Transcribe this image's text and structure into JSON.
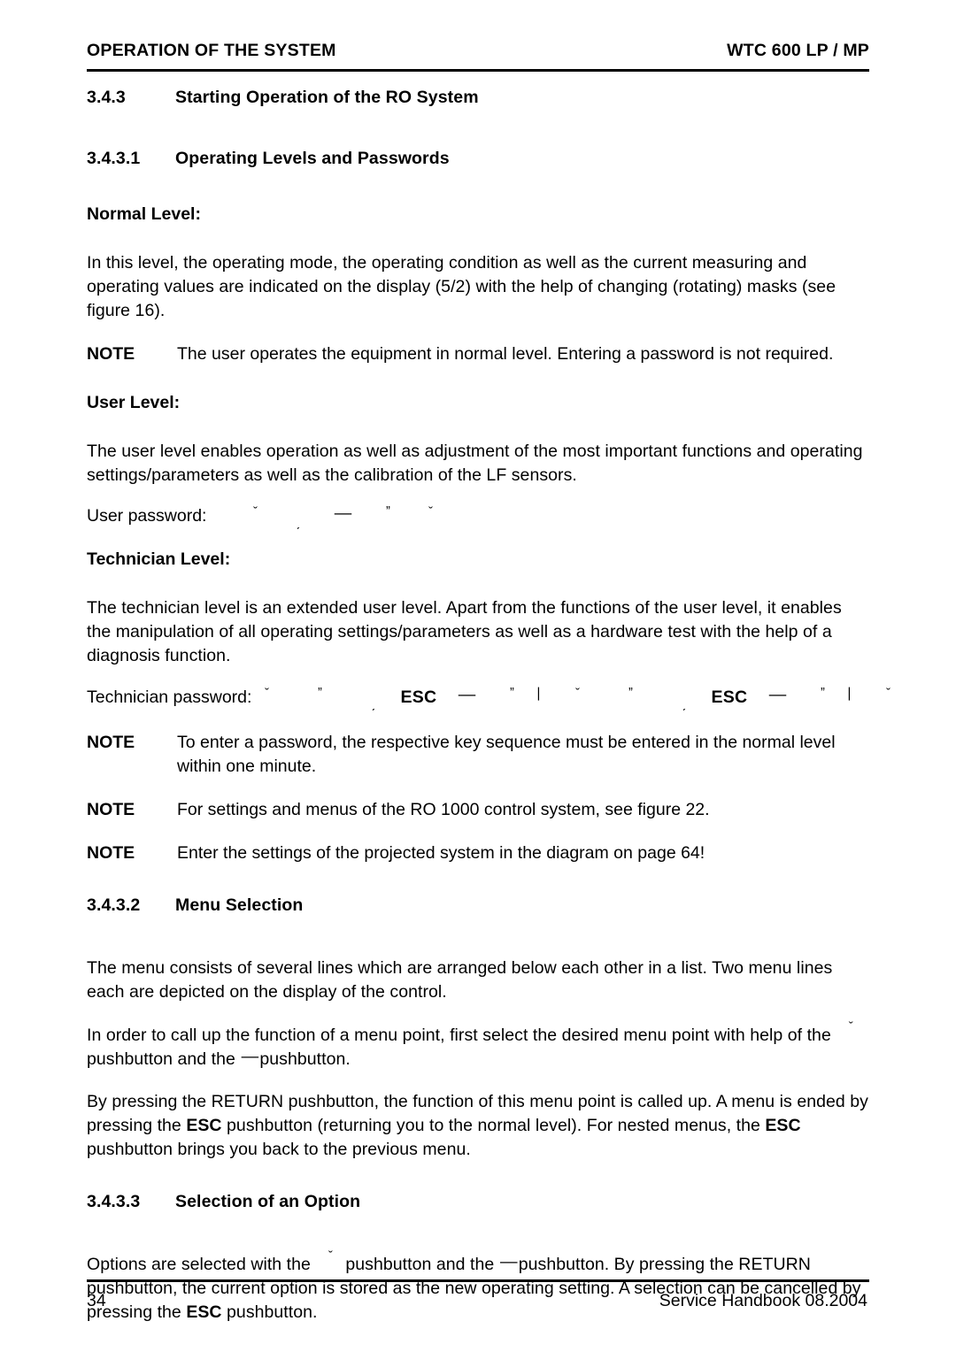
{
  "header": {
    "left": "OPERATION OF THE SYSTEM",
    "right": "WTC 600 LP / MP"
  },
  "sections": {
    "s343": {
      "num": "3.4.3",
      "title": "Starting Operation of the RO System"
    },
    "s3431": {
      "num": "3.4.3.1",
      "title": "Operating Levels and Passwords"
    },
    "s3432": {
      "num": "3.4.3.2",
      "title": "Menu Selection"
    },
    "s3433": {
      "num": "3.4.3.3",
      "title": "Selection of an Option"
    }
  },
  "normal_level": {
    "heading": "Normal Level:",
    "paragraph": "In this level, the operating mode, the operating condition as well as the current measuring and operating values are indicated on the display (5/2) with the help of changing (rotating) masks (see figure 16).",
    "note_label": "NOTE",
    "note_text": "The user operates the equipment in normal level. Entering a password is not required."
  },
  "user_level": {
    "heading": "User Level:",
    "paragraph": "The user level enables operation as well as adjustment of the most important functions and operating settings/parameters as well as the calibration of the LF sensors.",
    "password_label": "User password:",
    "password_keys": [
      "ˇ",
      "ˏ",
      "—",
      "ˮ",
      "ˇ"
    ]
  },
  "technician_level": {
    "heading": "Technician Level:",
    "paragraph": "The technician level is an extended user level. Apart from the functions of the user level, it enables the manipulation of all operating settings/parameters as well as a hardware test with the help of a diagnosis function.",
    "password_label": "Technician password:",
    "password_keys": [
      "ˇ",
      "ˮ",
      "ˏ",
      "ESC",
      "—",
      "ˮ",
      "❘",
      "ˇ",
      "ˮ",
      "ˏ",
      "ESC",
      "—",
      "ˮ",
      "❘",
      "ˇ"
    ]
  },
  "notes": [
    {
      "label": "NOTE",
      "text": "To enter a password, the respective key sequence must be entered in the normal level within one minute."
    },
    {
      "label": "NOTE",
      "text": "For settings and menus of the RO 1000 control system, see figure 22."
    },
    {
      "label": "NOTE",
      "text": "Enter the settings of the projected system in the diagram on page 64!"
    }
  ],
  "menu_selection": {
    "paragraph1": "The menu consists of several lines which are arranged below each other in a list. Two menu lines each are depicted on the display of the control.",
    "paragraph2_a": "In order to call up the function of a menu point, first select the desired menu point with help of the",
    "paragraph2_key1": "ˇ",
    "paragraph2_b": "pushbutton and the",
    "paragraph2_key2": "—",
    "paragraph2_c": "pushbutton.",
    "paragraph3_a": "By pressing the RETURN pushbutton, the function of this menu point is called up. A menu is ended by pressing the",
    "paragraph3_esc1": "ESC",
    "paragraph3_b": "pushbutton (returning you to the normal level). For nested menus, the",
    "paragraph3_esc2": "ESC",
    "paragraph3_c": "pushbutton brings you back to the previous menu."
  },
  "option_selection": {
    "paragraph_a": "Options are selected with the",
    "key1": "ˇ",
    "paragraph_b": "pushbutton and the",
    "key2": "—",
    "paragraph_c": "pushbutton. By pressing the RETURN pushbutton, the current option is stored as the new operating setting. A selection can be cancelled by pressing the",
    "esc": "ESC",
    "paragraph_d": "pushbutton."
  },
  "footer": {
    "page_number": "34",
    "imprint": "Service Handbook 08.2004"
  }
}
